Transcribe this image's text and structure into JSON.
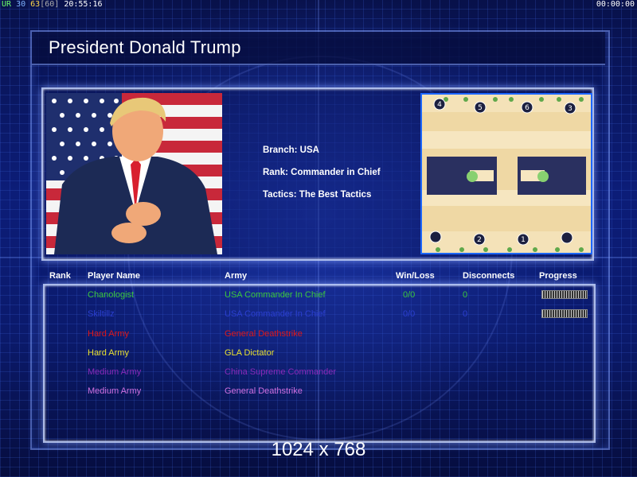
{
  "status_bar": {
    "ur": "UR",
    "n30": "30",
    "n63": "63",
    "n60": "[60]",
    "clock": "20:55:16",
    "timer": "00:00:00"
  },
  "title": "President Donald Trump",
  "details": {
    "branch": "Branch: USA",
    "rank": "Rank: Commander in Chief",
    "tactics": "Tactics: The Best Tactics"
  },
  "map": {
    "start_positions": [
      "4",
      "5",
      "6",
      "3",
      "2",
      "1"
    ]
  },
  "table": {
    "headers": {
      "rank": "Rank",
      "player_name": "Player Name",
      "army": "Army",
      "win_loss": "Win/Loss",
      "disconnects": "Disconnects",
      "progress": "Progress"
    },
    "rows": [
      {
        "name": "Chanologist",
        "army": "USA Commander In Chief",
        "win_loss": "0/0",
        "disconnects": "0",
        "color": "#3cc83c",
        "show_progress": true
      },
      {
        "name": "Skiltillz",
        "army": "USA Commander In Chief",
        "win_loss": "0/0",
        "disconnects": "0",
        "color": "#2b3fd0",
        "show_progress": true
      },
      {
        "name": "Hard Army",
        "army": "General Deathstrike",
        "win_loss": "",
        "disconnects": "",
        "color": "#e01818",
        "show_progress": false
      },
      {
        "name": "Hard Army",
        "army": "GLA Dictator",
        "win_loss": "",
        "disconnects": "",
        "color": "#e8e030",
        "show_progress": false
      },
      {
        "name": "Medium Army",
        "army": "China Supreme Commander",
        "win_loss": "",
        "disconnects": "",
        "color": "#8a2ab8",
        "show_progress": false
      },
      {
        "name": "Medium Army",
        "army": "General Deathstrike",
        "win_loss": "",
        "disconnects": "",
        "color": "#d070e0",
        "show_progress": false
      }
    ]
  },
  "resolution": "1024 x 768"
}
